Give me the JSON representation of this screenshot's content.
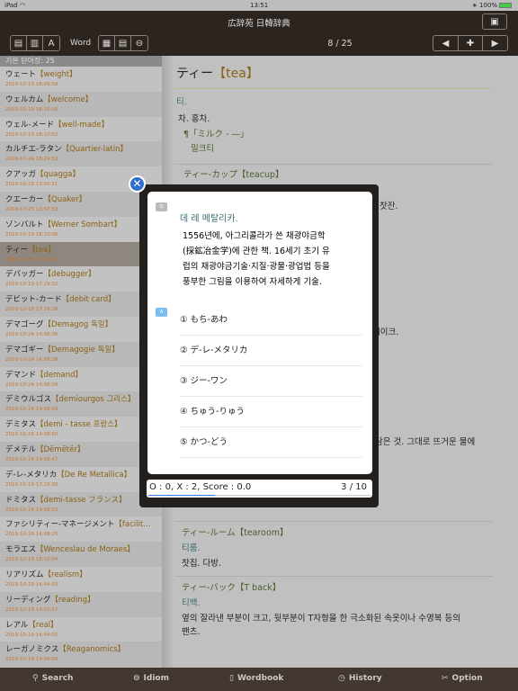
{
  "status_bar": {
    "device": "iPad",
    "time": "13:51",
    "battery": "100%"
  },
  "header": {
    "title": "広辞苑 日韓辞典",
    "mode_label": "Word",
    "page_counter": "8 / 25"
  },
  "wordbook": {
    "header": "기본 단어장: 25",
    "selected_index": 7,
    "items": [
      {
        "word": "ウェート",
        "orig": "【weight】",
        "date": "2018-10-19 18:09:58"
      },
      {
        "word": "ウェルカム",
        "orig": "【welcome】",
        "date": "2018-10-19 18:10:00"
      },
      {
        "word": "ウェル-メード",
        "orig": "【well-made】",
        "date": "2018-10-19 18:10:02"
      },
      {
        "word": "カルチエ-ラタン",
        "orig": "【Quartier-latin】",
        "date": "2018-10-24 18:24:53"
      },
      {
        "word": "クアッガ",
        "orig": "【quagga】",
        "date": "2018-10-25 13:50:51"
      },
      {
        "word": "クエーカー",
        "orig": "【Quaker】",
        "date": "2018-10-25 13:50:53"
      },
      {
        "word": "ゾンバルト",
        "orig": "【Werner Sombart】",
        "date": "2018-10-19 18:10:06"
      },
      {
        "word": "ティー",
        "orig": "【tea】",
        "date": "2018-10-25 13:51:00"
      },
      {
        "word": "デバッガー",
        "orig": "【debugger】",
        "date": "2018-10-19 17:29:32"
      },
      {
        "word": "デビット-カード",
        "orig": "【debit card】",
        "date": "2018-10-19 17:29:28"
      },
      {
        "word": "デマゴーグ",
        "orig": "【Demagog 독일】",
        "date": "2018-10-24 14:08:36"
      },
      {
        "word": "デマゴギー",
        "orig": "【Demagogie 독일】",
        "date": "2018-10-24 14:08:38"
      },
      {
        "word": "デマンド",
        "orig": "【demand】",
        "date": "2018-10-24 14:08:39"
      },
      {
        "word": "デミウルゴス",
        "orig": "【demiourgos 그리스】",
        "date": "2018-10-24 14:08:49"
      },
      {
        "word": "デミタス",
        "orig": "【demi - tasse 프랑스】",
        "date": "2018-10-24 14:08:50"
      },
      {
        "word": "デメテル",
        "orig": "【Dēmētēr】",
        "date": "2018-10-24 14:08:47"
      },
      {
        "word": "デ-レ-メタリカ",
        "orig": "【De Re Metallica】",
        "date": "2018-10-19 17:29:30"
      },
      {
        "word": "ドミタス",
        "orig": "【demi-tasse フランス】",
        "date": "2018-10-24 14:08:53"
      },
      {
        "word": "ファシリティー-マネージメント",
        "orig": "【facilit…",
        "date": "2018-10-24 14:08:25"
      },
      {
        "word": "モラエス",
        "orig": "【Wenceslau de Moraes】",
        "date": "2018-10-19 18:10:04"
      },
      {
        "word": "リアリズム",
        "orig": "【realism】",
        "date": "2018-10-19 14:04:03"
      },
      {
        "word": "リーディング",
        "orig": "【reading】",
        "date": "2018-10-19 14:03:57"
      },
      {
        "word": "レアル",
        "orig": "【real】",
        "date": "2018-10-19 14:04:02"
      },
      {
        "word": "レーガノミクス",
        "orig": "【Reaganomics】",
        "date": "2018-10-19 14:04:00"
      }
    ]
  },
  "entry": {
    "headword": "ティー",
    "orig": "【tea】",
    "reading": "티.",
    "meaning": "차. 홍차.",
    "example_jp": "¶「ミルク - ―」",
    "example_kr": "밀크티",
    "sub1_head": "ティー-カップ【teacup】",
    "sub1_frag": "찻잔.",
    "frag2": "레이크.",
    "frag3": "담은 것. 그대로 뜨거운 물에",
    "sub2_head": "ティー-ルーム【tearoom】",
    "sub2_reading": "티룸.",
    "sub2_meaning": "찻집. 다방.",
    "sub3_head": "ティー-バック【T back】",
    "sub3_reading": "티백.",
    "sub3_meaning_1": "옆의 잘라낸 부분이 크고, 뒷부분이 T자형을 한 극소화된 속옷이나 수영복 등의",
    "sub3_meaning_2": "팬츠."
  },
  "quiz": {
    "q_badge": "Q",
    "a_badge": "A",
    "question_title": "데 레 메탈리카.",
    "question_lines": [
      "1556년에, 아그리콜라가 쓴 채광야금학",
      "(採鉱冶金学)에 관한 책. 16세기 초기 유",
      "럽의 채광야금기술·지질·광물·광업법 등을",
      "풍부한 그림을 이용하여 자세하게 기술."
    ],
    "options": [
      "① もち-あわ",
      "② デ-レ-メタリカ",
      "③ ジー-ワン",
      "④ ちゅう-りゅう",
      "⑤ かつ-どう"
    ],
    "score_text": "O : 0, X : 2, Score : 0.0",
    "progress_text": "3 / 10",
    "progress": 0.3
  },
  "bottom_tabs": [
    "Search",
    "Idiom",
    "Wordbook",
    "History",
    "Option"
  ],
  "colors": {
    "header": "#2c241e",
    "accent_orig": "#8a6214",
    "teal": "#3a6a70",
    "close": "#2f6fd0",
    "progress": "#2f7be0"
  }
}
